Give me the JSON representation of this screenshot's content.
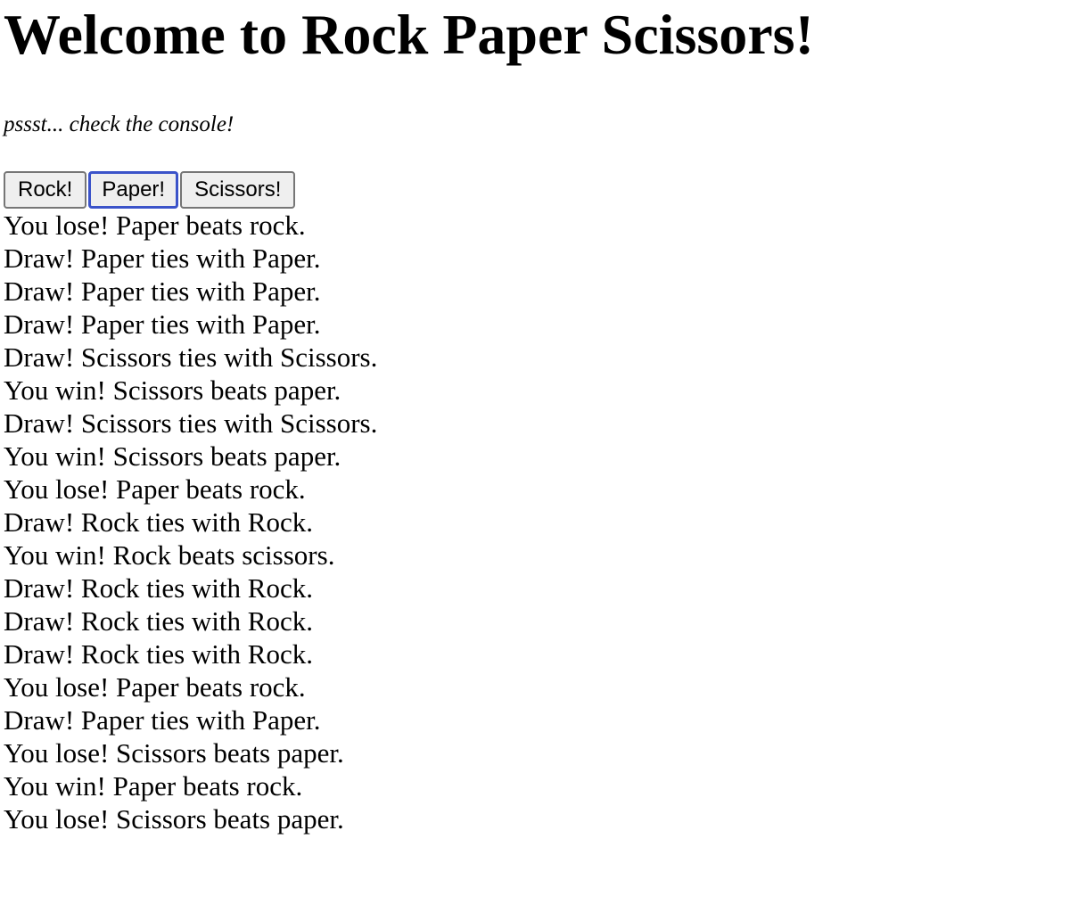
{
  "page": {
    "title": "Welcome to Rock Paper Scissors!",
    "hint": "pssst... check the console!"
  },
  "buttons": {
    "rock": "Rock!",
    "paper": "Paper!",
    "scissors": "Scissors!"
  },
  "results": [
    "You lose! Paper beats rock.",
    "Draw! Paper ties with Paper.",
    "Draw! Paper ties with Paper.",
    "Draw! Paper ties with Paper.",
    "Draw! Scissors ties with Scissors.",
    "You win! Scissors beats paper.",
    "Draw! Scissors ties with Scissors.",
    "You win! Scissors beats paper.",
    "You lose! Paper beats rock.",
    "Draw! Rock ties with Rock.",
    "You win! Rock beats scissors.",
    "Draw! Rock ties with Rock.",
    "Draw! Rock ties with Rock.",
    "Draw! Rock ties with Rock.",
    "You lose! Paper beats rock.",
    "Draw! Paper ties with Paper.",
    "You lose! Scissors beats paper.",
    "You win! Paper beats rock.",
    "You lose! Scissors beats paper."
  ]
}
